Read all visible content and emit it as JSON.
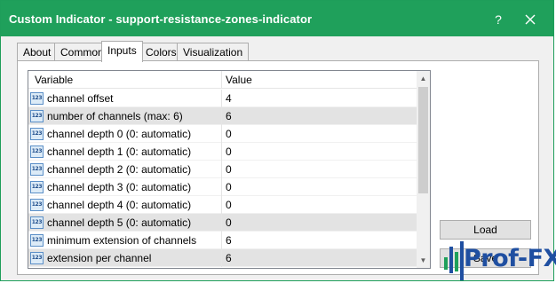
{
  "window": {
    "title": "Custom Indicator - support-resistance-zones-indicator",
    "help_glyph": "?"
  },
  "tabs": [
    {
      "label": "About"
    },
    {
      "label": "Common"
    },
    {
      "label": "Inputs"
    },
    {
      "label": "Colors"
    },
    {
      "label": "Visualization"
    }
  ],
  "grid": {
    "headers": {
      "variable": "Variable",
      "value": "Value"
    },
    "icon_text": "123",
    "rows": [
      {
        "name": "channel offset",
        "value": "4"
      },
      {
        "name": "number of channels (max: 6)",
        "value": "6"
      },
      {
        "name": "channel depth 0 (0: automatic)",
        "value": "0"
      },
      {
        "name": "channel depth 1 (0: automatic)",
        "value": "0"
      },
      {
        "name": "channel depth 2 (0: automatic)",
        "value": "0"
      },
      {
        "name": "channel depth 3 (0: automatic)",
        "value": "0"
      },
      {
        "name": "channel depth 4 (0: automatic)",
        "value": "0"
      },
      {
        "name": "channel depth 5 (0: automatic)",
        "value": "0"
      },
      {
        "name": "minimum extension of channels",
        "value": "6"
      },
      {
        "name": "extension per channel",
        "value": "6"
      }
    ]
  },
  "buttons": {
    "load": "Load",
    "save": "Save"
  },
  "watermark": {
    "text": "Prof-FX"
  },
  "colors": {
    "titlebar": "#1fa05b",
    "watermark": "#1f4fa1"
  }
}
